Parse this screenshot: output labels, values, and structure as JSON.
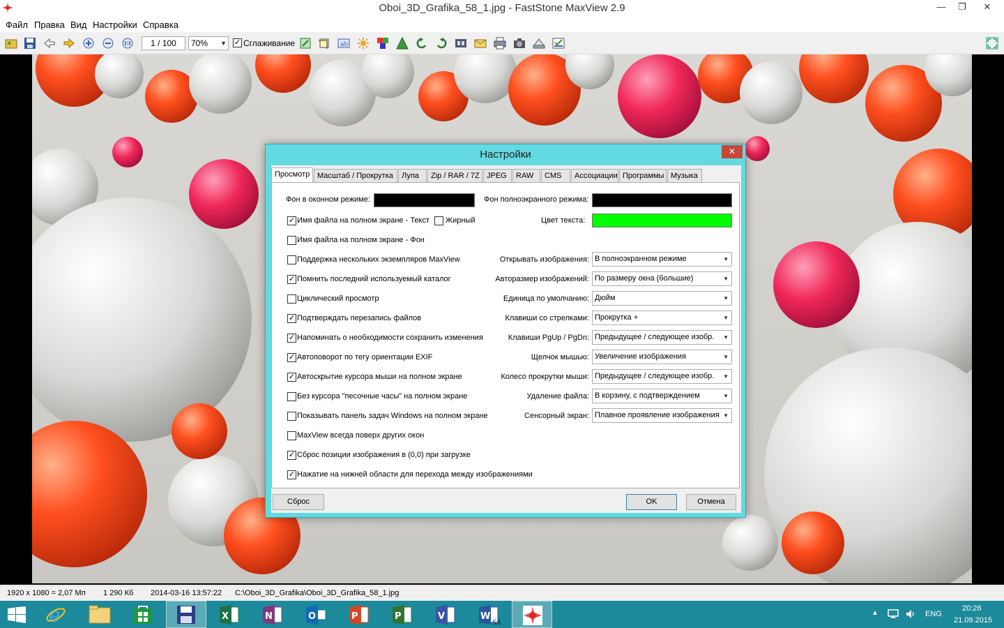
{
  "window": {
    "title": "Oboi_3D_Grafika_58_1.jpg - FastStone MaxView 2.9",
    "min": "—",
    "max": "❐",
    "close": "✕"
  },
  "menu": [
    "Файл",
    "Правка",
    "Вид",
    "Настройки",
    "Справка"
  ],
  "toolbar": {
    "page": "1 / 100",
    "zoom": "70%",
    "smoothing_label": "Сглаживание",
    "smoothing_checked": true
  },
  "status": {
    "dimensions": "1920 x 1080 = 2,07 Мп",
    "filesize": "1 290 Кб",
    "datetime": "2014-03-16 13:57:22",
    "path": "C:\\Oboi_3D_Grafika\\Oboi_3D_Grafika_58_1.jpg"
  },
  "taskbar": {
    "lang": "ENG",
    "time": "20:26",
    "date": "21.09.2015"
  },
  "dialog": {
    "title": "Настройки",
    "close": "✕",
    "tabs": [
      "Просмотр",
      "Масштаб / Прокрутка",
      "Лупа",
      "Zip / RAR / 7Z",
      "JPEG",
      "RAW",
      "CMS",
      "Ассоциации",
      "Программы",
      "Музыка"
    ],
    "bg_window_label": "Фон в оконном режиме:",
    "bg_full_label": "Фон полноэкранного режима:",
    "text_color_label": "Цвет текста:",
    "bold_label": "Жирный",
    "colors": {
      "bg_window": "#000000",
      "bg_full": "#000000",
      "text": "#00ff00"
    },
    "options": [
      {
        "label": "Имя файла на полном экране - Текст",
        "checked": true
      },
      {
        "label": "Имя файла на полном экране - Фон",
        "checked": false
      },
      {
        "label": "Поддержка нескольких экземпляров MaxView",
        "checked": false
      },
      {
        "label": "Помнить последний используемый каталог",
        "checked": true
      },
      {
        "label": "Циклический просмотр",
        "checked": false
      },
      {
        "label": "Подтверждать перезапись файлов",
        "checked": true
      },
      {
        "label": "Напоминать о необходимости сохранить изменения",
        "checked": true
      },
      {
        "label": "Автоповорот по тегу ориентации EXIF",
        "checked": true
      },
      {
        "label": "Автоскрытие курсора мыши на полном экране",
        "checked": true
      },
      {
        "label": "Без курсора \"песочные часы\" на полном экране",
        "checked": false
      },
      {
        "label": "Показывать панель задач Windows на полном экране",
        "checked": false
      },
      {
        "label": "MaxView всегда поверх других окон",
        "checked": false
      },
      {
        "label": "Сброс позиции изображения в (0,0) при загрузке",
        "checked": true
      },
      {
        "label": "Нажатие на нижней области для перехода между изображениями",
        "checked": true
      }
    ],
    "bold_checked": false,
    "selects": [
      {
        "label": "Открывать изображения:",
        "value": "В полноэкранном режиме"
      },
      {
        "label": "Авторазмер изображений:",
        "value": "По размеру окна (большие)"
      },
      {
        "label": "Единица по умолчанию:",
        "value": "Дюйм"
      },
      {
        "label": "Клавиши со стрелками:",
        "value": "Прокрутка +"
      },
      {
        "label": "Клавиши PgUp / PgDn:",
        "value": "Предыдущее / следующее изобр."
      },
      {
        "label": "Щелчок мышью:",
        "value": "Увеличение изображения"
      },
      {
        "label": "Колесо прокрутки мыши:",
        "value": "Предыдущее / следующее изобр."
      },
      {
        "label": "Удаление файла:",
        "value": "В корзину, с подтверждением"
      },
      {
        "label": "Сенсорный экран:",
        "value": "Плавное проявление изображения"
      }
    ],
    "buttons": {
      "reset": "Сброс",
      "ok": "OK",
      "cancel": "Отмена"
    }
  }
}
